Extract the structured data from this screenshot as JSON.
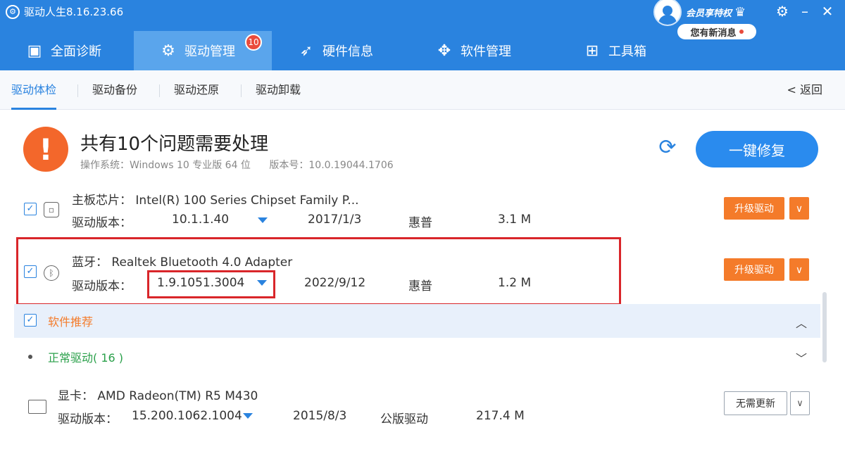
{
  "window": {
    "title": "驱动人生8.16.23.66"
  },
  "user": {
    "vip_label": "会员享特权",
    "message_pill": "您有新消息"
  },
  "nav": {
    "items": [
      {
        "label": "全面诊断",
        "icon": "monitor-icon"
      },
      {
        "label": "驱动管理",
        "icon": "gear-icon",
        "badge": "10"
      },
      {
        "label": "硬件信息",
        "icon": "rocket-icon"
      },
      {
        "label": "软件管理",
        "icon": "apps-icon"
      },
      {
        "label": "工具箱",
        "icon": "toolbox-icon"
      }
    ]
  },
  "subtabs": {
    "items": [
      "驱动体检",
      "驱动备份",
      "驱动还原",
      "驱动卸载"
    ],
    "back": "< 返回"
  },
  "summary": {
    "headline": "共有10个问题需要处理",
    "os": "操作系统：Windows 10 专业版 64 位",
    "version": "版本号：10.0.19044.1706",
    "fix_button": "一键修复"
  },
  "drivers": [
    {
      "name": "主板芯片：  Intel(R) 100 Series Chipset Family P...",
      "version_label": "驱动版本：",
      "version": "10.1.1.40",
      "date": "2017/1/3",
      "vendor": "惠普",
      "size": "3.1 M",
      "action": "升级驱动"
    },
    {
      "name": "蓝牙：  Realtek Bluetooth 4.0 Adapter",
      "version_label": "驱动版本：",
      "version": "1.9.1051.3004",
      "date": "2022/9/12",
      "vendor": "惠普",
      "size": "1.2 M",
      "action": "升级驱动"
    }
  ],
  "software_section": {
    "label": "软件推荐"
  },
  "normal_section": {
    "label": "正常驱动( 16 )"
  },
  "gpu": {
    "name": "显卡：  AMD Radeon(TM) R5 M430",
    "version_label": "驱动版本：",
    "version": "15.200.1062.1004",
    "date": "2015/8/3",
    "vendor": "公版驱动",
    "size": "217.4 M",
    "action": "无需更新"
  },
  "colors": {
    "primary": "#2a83df",
    "warning": "#f3672b",
    "upgrade": "#f47b2a",
    "highlight": "#d9262a",
    "normal": "#2aa04a"
  }
}
